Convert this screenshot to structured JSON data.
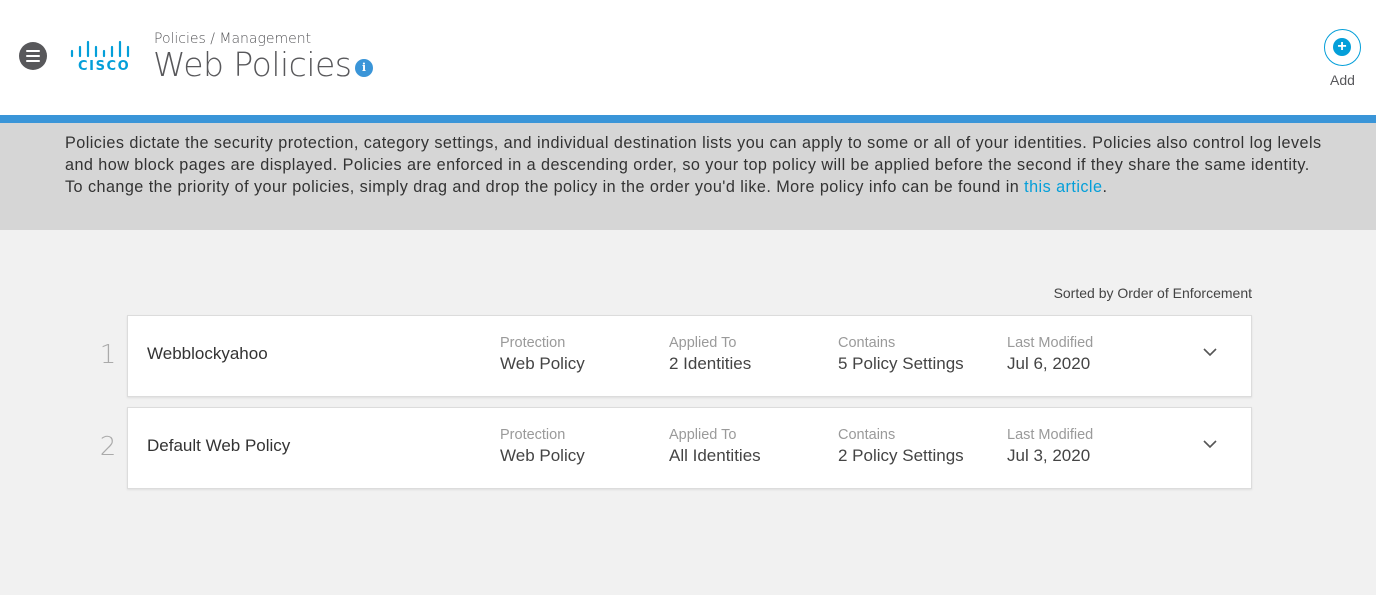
{
  "header": {
    "breadcrumb": "Policies / Management",
    "title": "Web Policies",
    "info_icon": "i",
    "logo_word": "CISCO",
    "add_label": "Add"
  },
  "notice": {
    "text": "Policies dictate the security protection, category settings, and individual destination lists you can apply to some or all of your identities. Policies also control log levels and how block pages are displayed. Policies are enforced in a descending order, so your top policy will be applied before the second if they share the same identity. To change the priority of your policies, simply drag and drop the policy in the order you'd like. More policy info can be found in ",
    "link": "this article",
    "suffix": "."
  },
  "sort_label": "Sorted by Order of Enforcement",
  "columns": {
    "protection": "Protection",
    "applied_to": "Applied To",
    "contains": "Contains",
    "last_modified": "Last Modified"
  },
  "policies": [
    {
      "order": "1",
      "name": "Webblockyahoo",
      "protection": "Web Policy",
      "applied_to": "2 Identities",
      "contains": "5 Policy Settings",
      "last_modified": "Jul 6, 2020"
    },
    {
      "order": "2",
      "name": "Default Web Policy",
      "protection": "Web Policy",
      "applied_to": "All Identities",
      "contains": "2 Policy Settings",
      "last_modified": "Jul 3, 2020"
    }
  ],
  "colors": {
    "accent": "#049fd9",
    "bar": "#3a95d8",
    "notice_bg": "#d6d6d6"
  }
}
